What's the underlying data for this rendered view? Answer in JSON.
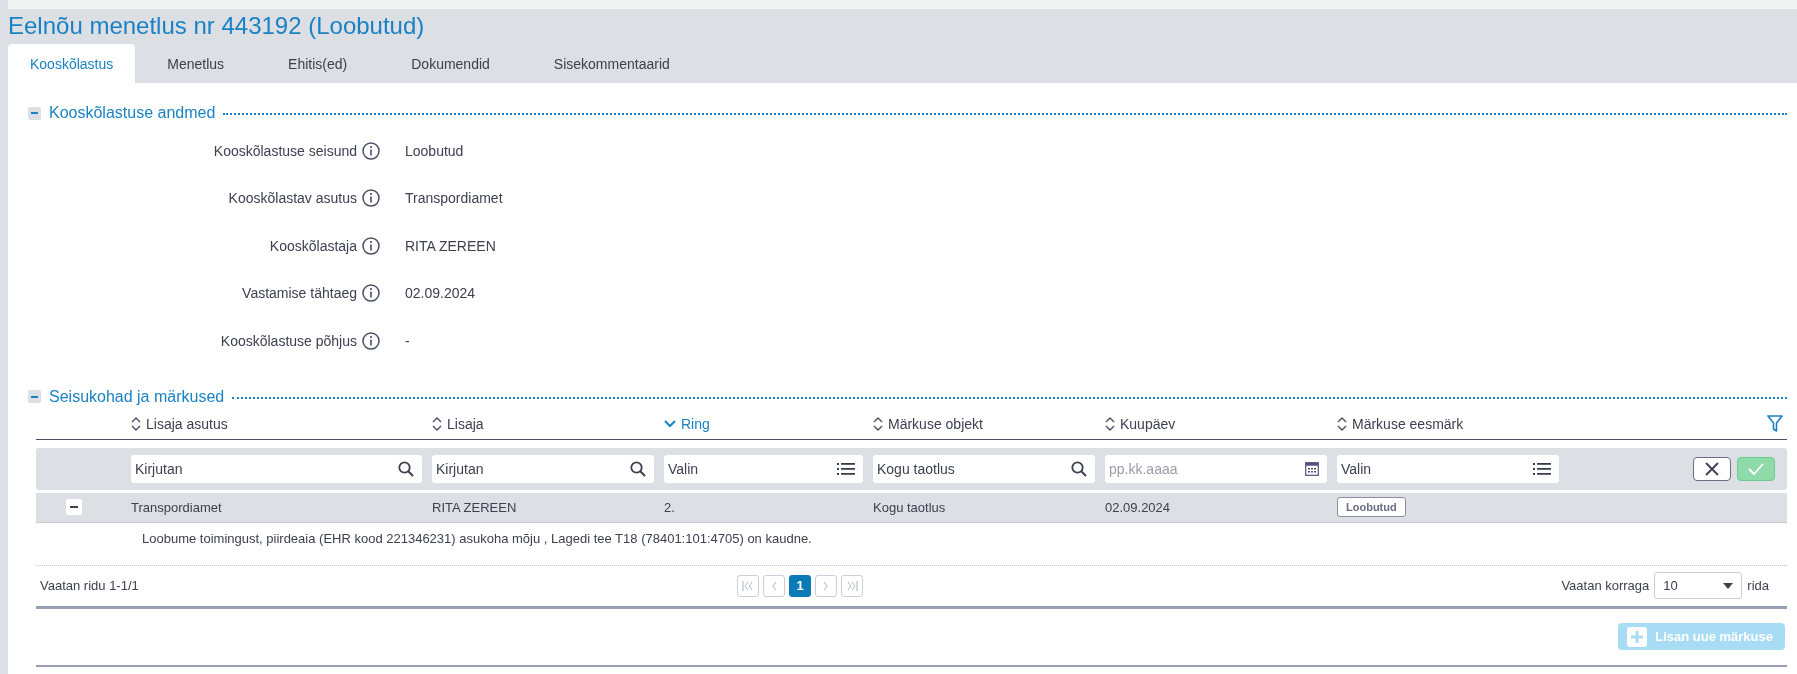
{
  "window": {
    "title": "Eelnõu menetlus nr 443192 (Loobutud)"
  },
  "tabs": [
    {
      "label": "Kooskõlastus",
      "selected": true
    },
    {
      "label": "Menetlus",
      "selected": false
    },
    {
      "label": "Ehitis(ed)",
      "selected": false
    },
    {
      "label": "Dokumendid",
      "selected": false
    },
    {
      "label": "Sisekommentaarid",
      "selected": false
    }
  ],
  "details_section": {
    "title": "Kooskõlastuse andmed",
    "expanded": true,
    "fields": [
      {
        "label": "Kooskõlastuse seisund",
        "value": "Loobutud"
      },
      {
        "label": "Kooskõlastav asutus",
        "value": "Transpordiamet"
      },
      {
        "label": "Kooskõlastaja",
        "value": "RITA ZEREEN"
      },
      {
        "label": "Vastamise tähtaeg",
        "value": "02.09.2024"
      },
      {
        "label": "Kooskõlastuse põhjus",
        "value": "-"
      }
    ]
  },
  "remarks_section": {
    "title": "Seisukohad ja märkused",
    "expanded": true,
    "table": {
      "columns": [
        {
          "label": "Lisaja asutus",
          "sorted": false,
          "filter": {
            "kind": "search",
            "placeholder": "Kirjutan"
          }
        },
        {
          "label": "Lisaja",
          "sorted": false,
          "filter": {
            "kind": "search",
            "placeholder": "Kirjutan"
          }
        },
        {
          "label": "Ring",
          "sorted": true,
          "filter": {
            "kind": "select",
            "placeholder": "Valin"
          }
        },
        {
          "label": "Märkuse objekt",
          "sorted": false,
          "filter": {
            "kind": "search",
            "value": "Kogu taotlus"
          }
        },
        {
          "label": "Kuupäev",
          "sorted": false,
          "filter": {
            "kind": "date",
            "placeholder": "pp.kk.aaaa"
          }
        },
        {
          "label": "Märkuse eesmärk",
          "sorted": false,
          "filter": {
            "kind": "select",
            "placeholder": "Valin"
          }
        }
      ],
      "rows": [
        {
          "expanded": true,
          "cells": [
            "Transpordiamet",
            "RITA ZEREEN",
            "2.",
            "Kogu taotlus",
            "02.09.2024"
          ],
          "status": "Loobutud",
          "note": "Loobume toimingust, piirdeaia (EHR kood 221346231) asukoha mõju , Lagedi tee T18 (78401:101:4705) on kaudne."
        }
      ]
    },
    "pagination": {
      "summary": "Vaatan ridu 1-1/1",
      "pages": [
        {
          "label": "1",
          "selected": true
        }
      ],
      "nav_disabled": true,
      "page_size_label": "Vaatan korraga",
      "page_size": "10",
      "page_size_suffix": "rida"
    },
    "add_button": {
      "label": "Lisan uue märkuse",
      "disabled": true
    }
  }
}
